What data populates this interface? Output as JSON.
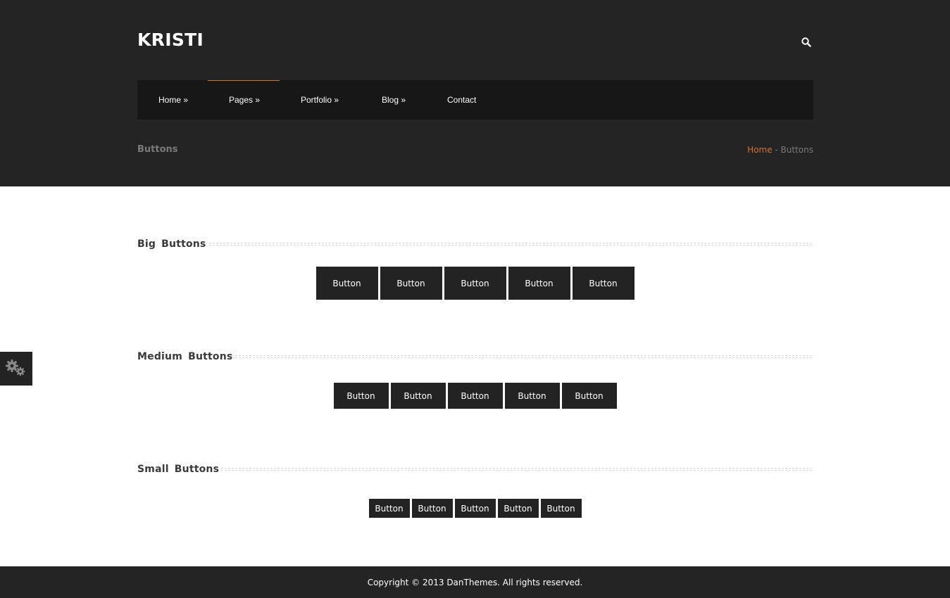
{
  "header": {
    "logo": "KRISTI",
    "search_icon": "search-icon",
    "page_title": "Buttons",
    "breadcrumb": {
      "home": "Home",
      "separator": " - ",
      "current": "Buttons"
    }
  },
  "nav": {
    "items": [
      {
        "label": "Home »"
      },
      {
        "label": "Pages »",
        "active": true
      },
      {
        "label": "Portfolio »"
      },
      {
        "label": "Blog »"
      },
      {
        "label": "Contact"
      }
    ]
  },
  "sections": {
    "big": {
      "title": "Big Buttons",
      "buttons": [
        "Button",
        "Button",
        "Button",
        "Button",
        "Button"
      ]
    },
    "medium": {
      "title": "Medium Buttons",
      "buttons": [
        "Button",
        "Button",
        "Button",
        "Button",
        "Button"
      ]
    },
    "small": {
      "title": "Small Buttons",
      "buttons": [
        "Button",
        "Button",
        "Button",
        "Button",
        "Button"
      ]
    }
  },
  "style_switcher": {
    "icon": "gear-icon"
  },
  "footer": {
    "copyright": "Copyright © 2013 DanThemes. All rights reserved."
  },
  "colors": {
    "header_bg": "#242424",
    "nav_bg": "#171717",
    "accent": "#d4722a",
    "button_bg": "#232323"
  }
}
